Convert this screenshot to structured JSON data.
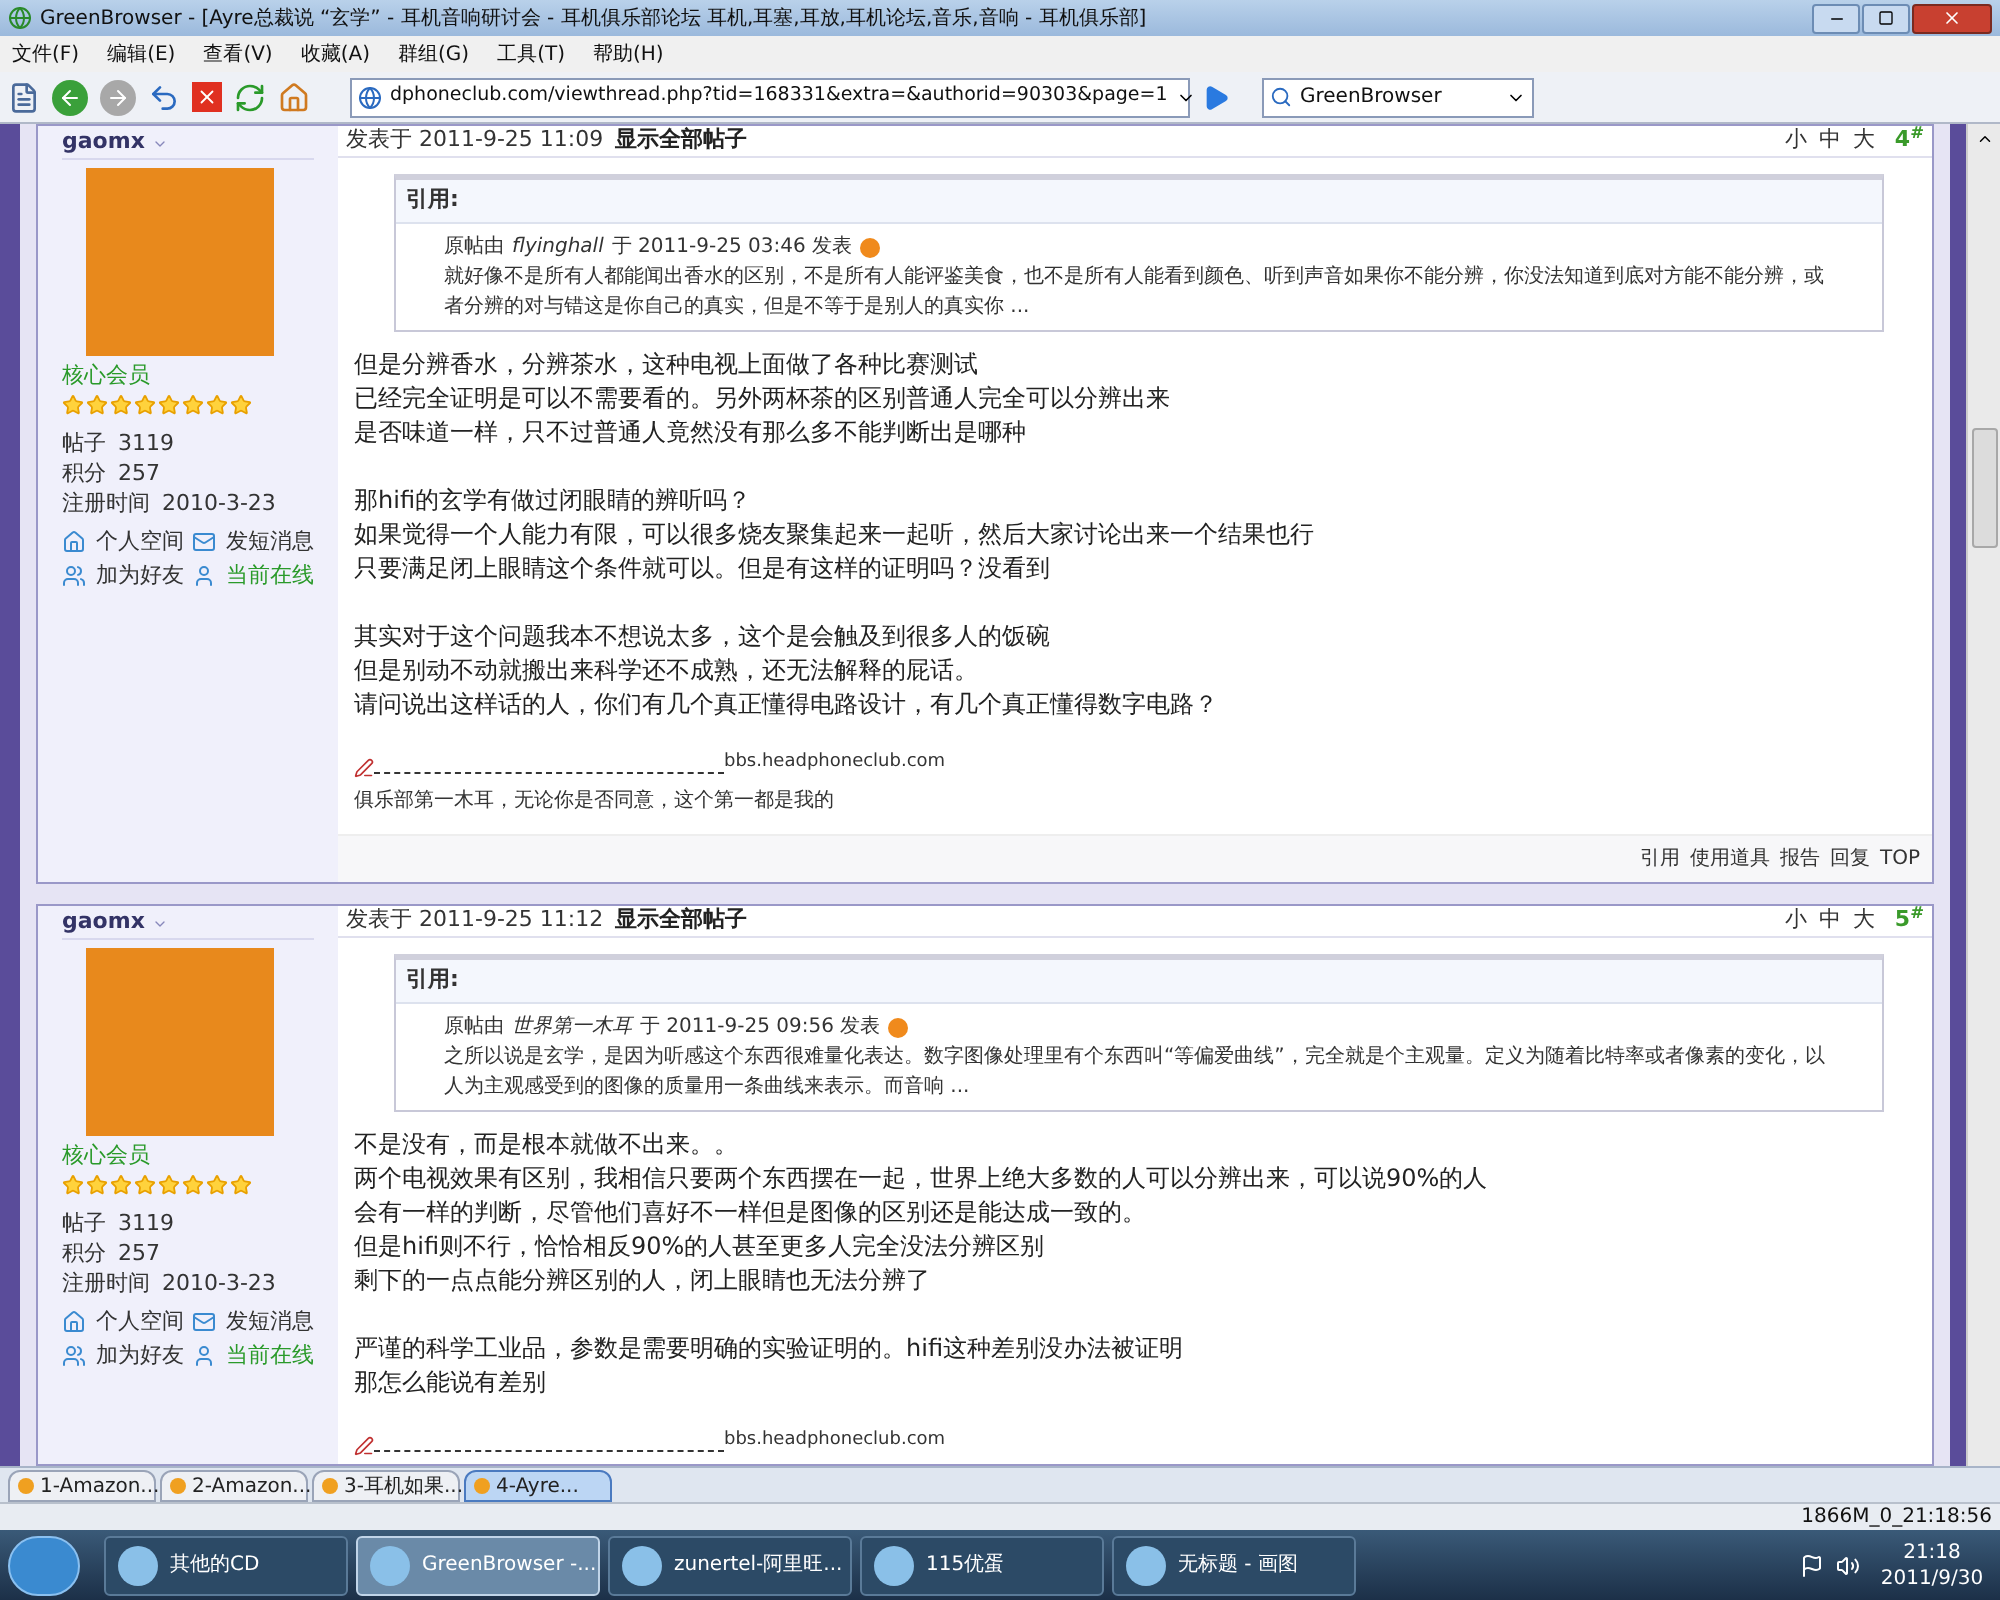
{
  "window": {
    "title": "GreenBrowser - [Ayre总裁说 “玄学” - 耳机音响研讨会 - 耳机俱乐部论坛 耳机,耳塞,耳放,耳机论坛,音乐,音响 - 耳机俱乐部]"
  },
  "menu": [
    "文件(F)",
    "编辑(E)",
    "查看(V)",
    "收藏(A)",
    "群组(G)",
    "工具(T)",
    "帮助(H)"
  ],
  "address": {
    "value": "dphoneclub.com/viewthread.php?tid=168331&extra=&authorid=90303&page=1"
  },
  "search": {
    "value": "GreenBrowser"
  },
  "posts": [
    {
      "author": "gaomx",
      "rank": "核心会员",
      "stars": 8,
      "stats": [
        {
          "label": "帖子",
          "value": "3119"
        },
        {
          "label": "积分",
          "value": "257"
        },
        {
          "label": "注册时间",
          "value": "2010-3-23"
        }
      ],
      "actions": [
        {
          "kind": "space",
          "label": "个人空间"
        },
        {
          "kind": "message",
          "label": "发短消息"
        },
        {
          "kind": "friend",
          "label": "加为好友"
        },
        {
          "kind": "online",
          "label": "当前在线"
        }
      ],
      "posted": "发表于  2011-9-25 11:09",
      "show_all": "显示全部帖子",
      "font_sizes": [
        "小",
        "中",
        "大"
      ],
      "floor": "4$^{#}$",
      "quote": {
        "heading": "引用:",
        "intro": "原帖由",
        "author": "flyinghall",
        "posted": "于  2011-9-25 03:46 发表",
        "text": "就好像不是所有人都能闻出香水的区别，不是所有人能评鉴美食，也不是所有人能看到颜色、听到声音如果你不能分辨，你没法知道到底对方能不能分辨，或者分辨的对与错这是你自己的真实，但是不等于是别人的真实你  ..."
      },
      "paragraphs": [
        [
          "但是分辨香水，分辨茶水，这种电视上面做了各种比赛测试",
          "已经完全证明是可以不需要看的。另外两杯茶的区别普通人完全可以分辨出来",
          "是否味道一样，只不过普通人竟然没有那么多不能判断出是哪种"
        ],
        [
          "那hifi的玄学有做过闭眼睛的辨听吗？",
          "如果觉得一个人能力有限，可以很多烧友聚集起来一起听，然后大家讨论出来一个结果也行",
          "只要满足闭上眼睛这个条件就可以。但是有这样的证明吗？没看到"
        ],
        [
          "其实对于这个问题我本不想说太多，这个是会触及到很多人的饭碗",
          "但是别动不动就搬出来科学还不成熟，还无法解释的屁话。",
          "请问说出这样话的人，你们有几个真正懂得电路设计，有几个真正懂得数字电路？"
        ]
      ],
      "signature": {
        "site": "bbs.headphoneclub.com",
        "text": "俱乐部第一木耳，无论你是否同意，这个第一都是我的"
      },
      "links": [
        "引用",
        "使用道具",
        "报告",
        "回复",
        "TOP"
      ]
    },
    {
      "author": "gaomx",
      "rank": "核心会员",
      "stars": 8,
      "stats": [
        {
          "label": "帖子",
          "value": "3119"
        },
        {
          "label": "积分",
          "value": "257"
        },
        {
          "label": "注册时间",
          "value": "2010-3-23"
        }
      ],
      "actions": [
        {
          "kind": "space",
          "label": "个人空间"
        },
        {
          "kind": "message",
          "label": "发短消息"
        },
        {
          "kind": "friend",
          "label": "加为好友"
        },
        {
          "kind": "online",
          "label": "当前在线"
        }
      ],
      "posted": "发表于  2011-9-25 11:12",
      "show_all": "显示全部帖子",
      "font_sizes": [
        "小",
        "中",
        "大"
      ],
      "floor": "5$^{#}$",
      "quote": {
        "heading": "引用:",
        "intro": "原帖由",
        "author": "世界第一木耳",
        "posted": "于  2011-9-25 09:56 发表",
        "text": "之所以说是玄学，是因为听感这个东西很难量化表达。数字图像处理里有个东西叫“等偏爱曲线”，完全就是个主观量。定义为随着比特率或者像素的变化，以人为主观感受到的图像的质量用一条曲线来表示。而音响  ..."
      },
      "paragraphs": [
        [
          "不是没有，而是根本就做不出来。。",
          "两个电视效果有区别，我相信只要两个东西摆在一起，世界上绝大多数的人可以分辨出来，可以说90%的人",
          "会有一样的判断，尽管他们喜好不一样但是图像的区别还是能达成一致的。",
          "但是hifi则不行，恰恰相反90%的人甚至更多人完全没法分辨区别",
          "剩下的一点点能分辨区别的人，闭上眼睛也无法分辨了"
        ],
        [
          "严谨的科学工业品，参数是需要明确的实验证明的。hifi这种差别没办法被证明",
          "那怎么能说有差别"
        ]
      ],
      "signature": {
        "site": "bbs.headphoneclub.com"
      }
    }
  ],
  "tabs": [
    {
      "label": "1-Amazon...",
      "selected": false
    },
    {
      "label": "2-Amazon...",
      "selected": false
    },
    {
      "label": "3-耳机如果...",
      "selected": false
    },
    {
      "label": "4-Ayre...",
      "selected": true
    }
  ],
  "status": {
    "text": "1866M_0_21:18:56"
  },
  "taskbar": {
    "items": [
      {
        "label": "其他的CD",
        "selected": false
      },
      {
        "label": "GreenBrowser -...",
        "selected": true
      },
      {
        "label": "zunertel-阿里旺...",
        "selected": false
      },
      {
        "label": "115优蛋",
        "selected": false
      },
      {
        "label": "无标题 - 画图",
        "selected": false
      }
    ],
    "time": "21:18",
    "date": "2011/9/30"
  }
}
